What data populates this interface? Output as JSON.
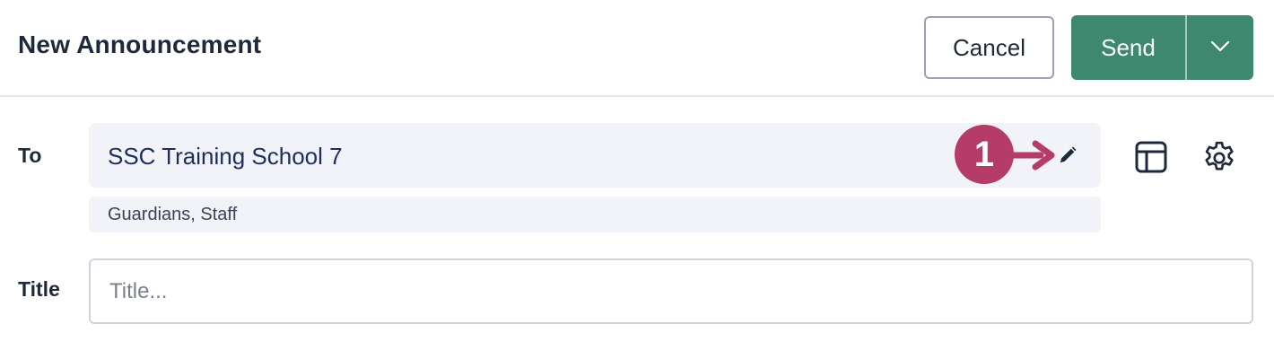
{
  "header": {
    "title": "New Announcement",
    "cancel_label": "Cancel",
    "send_label": "Send"
  },
  "recipients": {
    "to_label": "To",
    "to_value": "SSC Training School 7",
    "audience": "Guardians, Staff"
  },
  "title_field": {
    "label": "Title",
    "placeholder": "Title...",
    "value": ""
  },
  "callout": {
    "number": "1"
  },
  "icons": {
    "edit": "pencil-icon",
    "layout": "layout-template-icon",
    "settings": "gear-icon",
    "send_menu": "chevron-down-icon",
    "callout_arrow": "arrow-right-icon"
  },
  "colors": {
    "send_button": "#3f8870",
    "callout": "#b43c66",
    "field_background": "#f1f3f8",
    "cancel_border": "#9aa0b8"
  }
}
